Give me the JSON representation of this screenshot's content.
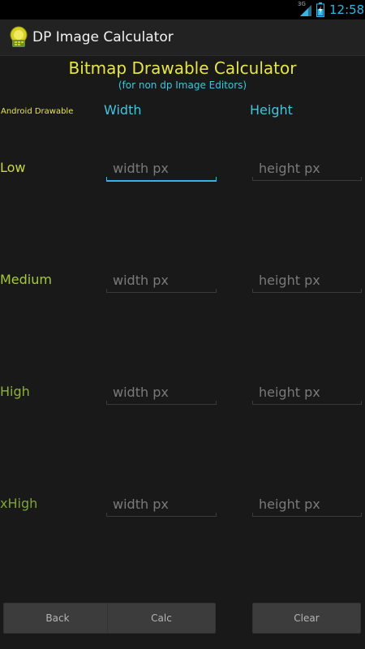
{
  "status_bar": {
    "network_label": "3G",
    "time": "12:58",
    "time_color": "#33b5e5"
  },
  "action_bar": {
    "app_icon": "app-logo-icon",
    "title": "DP Image Calculator"
  },
  "header": {
    "title": "Bitmap Drawable Calculator",
    "subtitle": "(for non dp Image Editors)"
  },
  "columns": {
    "drawable": "Android Drawable",
    "width": "Width",
    "height": "Height"
  },
  "rows": [
    {
      "label": "Low",
      "width_placeholder": "width px",
      "height_placeholder": "height px",
      "width_value": "",
      "height_value": "",
      "focused": "width"
    },
    {
      "label": "Medium",
      "width_placeholder": "width px",
      "height_placeholder": "height px",
      "width_value": "",
      "height_value": ""
    },
    {
      "label": "High",
      "width_placeholder": "width px",
      "height_placeholder": "height px",
      "width_value": "",
      "height_value": ""
    },
    {
      "label": "xHigh",
      "width_placeholder": "width px",
      "height_placeholder": "height px",
      "width_value": "",
      "height_value": ""
    }
  ],
  "buttons": {
    "back": "Back",
    "calc": "Calc",
    "clear": "Clear"
  },
  "colors": {
    "title_yellow": "#e6e64a",
    "accent_cyan": "#41c4e0",
    "focus_blue": "#33b5e5",
    "background": "#191919"
  }
}
